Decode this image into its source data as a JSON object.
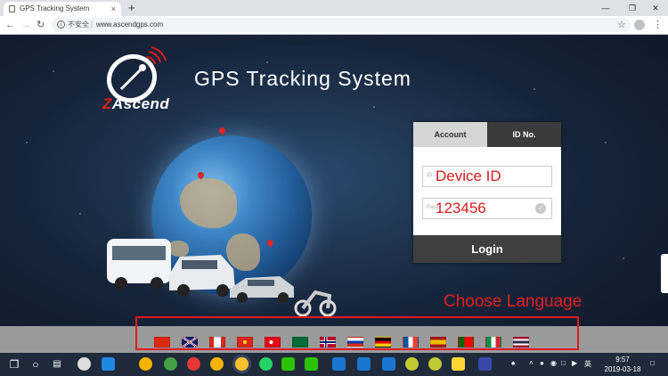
{
  "browser": {
    "tab_title": "GPS Tracking System",
    "tab_close": "×",
    "new_tab": "+",
    "insecure_label": "不安全",
    "separator": "|",
    "url": "www.ascendgps.com",
    "window_minimize": "—",
    "window_restore": "❐",
    "window_close": "✕"
  },
  "brand": {
    "logo_z": "Z",
    "logo_rest": "Ascend",
    "title": "GPS Tracking System"
  },
  "login": {
    "tab_account": "Account",
    "tab_idno": "ID No.",
    "device_id_placeholder": "ID",
    "device_id_value": "Device ID",
    "password_placeholder": "Pass",
    "password_value": "123456",
    "login_button": "Login"
  },
  "language": {
    "label": "Choose Language",
    "flags": [
      "china-flag",
      "uk-flag",
      "canada-flag",
      "vietnam-flag",
      "turkey-flag",
      "saudi-flag",
      "norway-flag",
      "russia-flag",
      "germany-flag",
      "france-flag",
      "spain-flag",
      "portugal-flag",
      "italy-flag",
      "thailand-flag"
    ]
  },
  "taskbar": {
    "ime_label": "英",
    "time": "9:57",
    "date": "2019-03-18"
  },
  "colors": {
    "accent_red": "#e01a1a",
    "panel_dark": "#3f3f3f"
  }
}
